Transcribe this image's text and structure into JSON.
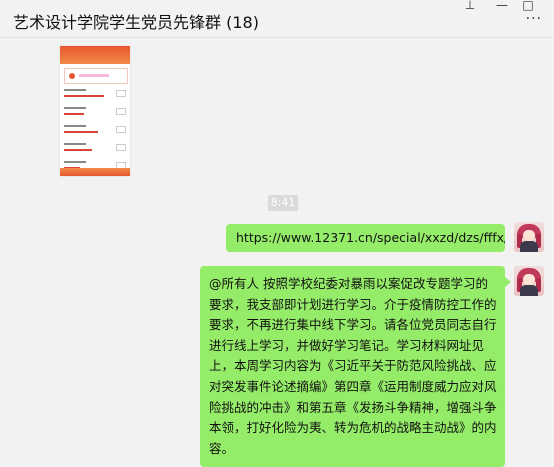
{
  "header": {
    "title": "艺术设计学院学生党员先锋群 (18)",
    "pin_glyph": "⊥",
    "minimize_glyph": "—",
    "maximize_glyph": "□",
    "more_glyph": "···"
  },
  "messages": {
    "image_thumbnail": {
      "icon": "screenshot-image"
    },
    "time_divider": "8:41",
    "link_message": "https://www.12371.cn/special/xxzd/dzs/fffx/",
    "text_message": "@所有人 按照学校纪委对暴雨以案促改专题学习的要求，我支部即计划进行学习。介于疫情防控工作的要求，不再进行集中线下学习。请各位党员同志自行进行线上学习，并做好学习笔记。学习材料网址见上，本周学习内容为《习近平关于防范风险挑战、应对突发事件论述摘编》第四章《运用制度威力应对风险挑战的冲击》和第五章《发扬斗争精神，增强斗争本领，打好化险为夷、转为危机的战略主动战》的内容。"
  },
  "colors": {
    "bubble_self": "#95ec69",
    "background": "#f2f2f2",
    "time_badge": "#dadada"
  }
}
